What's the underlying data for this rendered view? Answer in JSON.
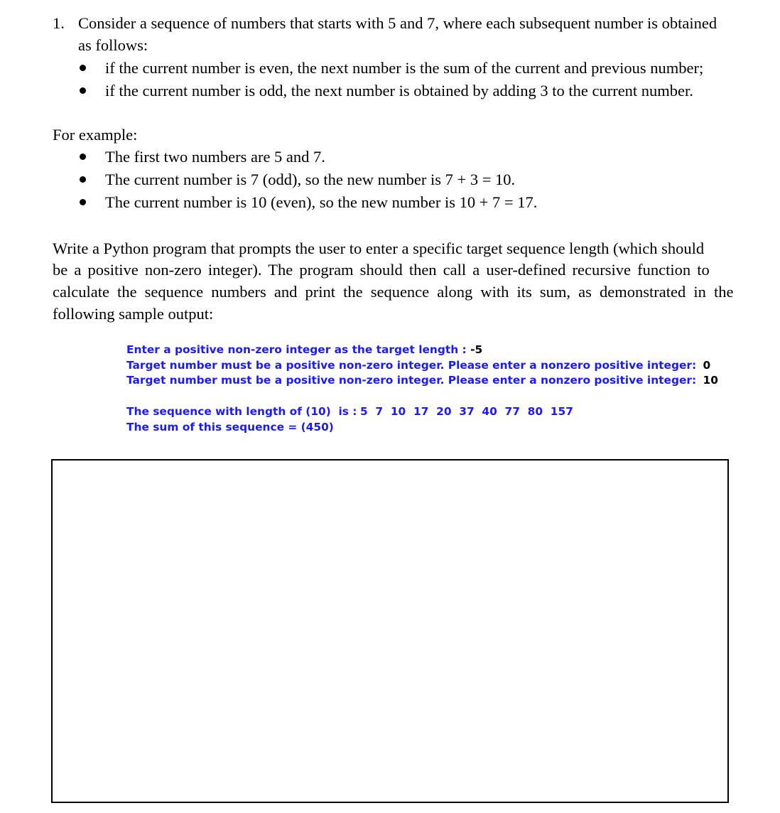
{
  "question": {
    "number": "1.",
    "intro_line1": "Consider a sequence of numbers that starts with 5 and 7, where each subsequent number is obtained",
    "intro_line2": "as follows:",
    "rules": [
      "if the current number is even, the next number is the sum of the current and previous number;",
      "if the current number is odd, the next number is obtained by adding 3 to the current number."
    ],
    "example_heading": "For example:",
    "examples": [
      "The first two numbers are 5 and 7.",
      "The current number is 7 (odd), so the new number is 7 + 3 = 10.",
      "The current number is 10 (even), so the new number is 10 + 7 = 17."
    ],
    "task_lines": [
      "Write a Python program that prompts the user to enter a specific target sequence length (which should",
      "be a positive non-zero integer). The program should then call a user-defined recursive function to",
      "calculate the sequence numbers and print the sequence along with its sum, as demonstrated in the",
      "following sample output:"
    ]
  },
  "sample_output": {
    "prompt": "Enter a positive non-zero integer as the target length : ",
    "input1": "-5",
    "error_prompt": "Target number must be a positive non-zero integer. Please enter a nonzero positive integer: ",
    "input2": "0",
    "input3": "10",
    "sequence_label": "The sequence with length of (10)  is :",
    "sequence_values": "5  7  10  17  20  37  40  77  80  157",
    "sum_line": "The sum of this sequence = (450)",
    "prompt_color": "#1a1aff",
    "input_color": "#000000"
  },
  "answer_box": {
    "value": ""
  }
}
